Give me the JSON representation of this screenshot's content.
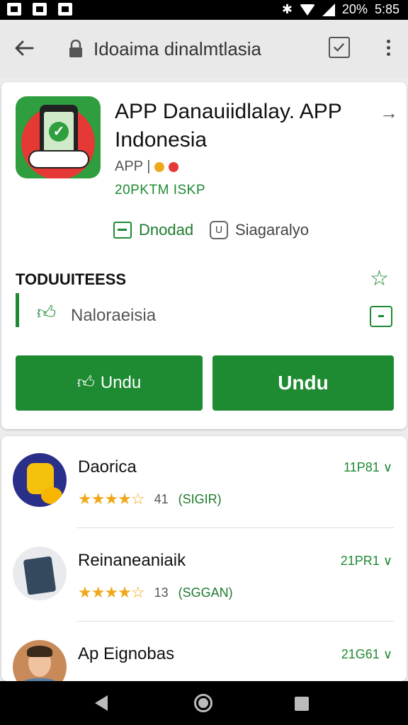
{
  "status_bar": {
    "battery": "20%",
    "time": "5:85"
  },
  "address_bar": {
    "url": "Idoaima dinalmtlasia",
    "icons": [
      "back-arrow-icon",
      "lock-icon",
      "tab-switcher-icon",
      "overflow-menu-icon"
    ]
  },
  "app": {
    "title": "APP Danauiidlalay. APP Indonesia",
    "meta_label": "APP |",
    "size_info": "20PKTM ISKP",
    "download_label": "Dnodad",
    "share_label": "Siagaralyo",
    "section_heading": "TODUUITEESS",
    "feature_label": "Naloraeisia",
    "button_left_label": "Undu",
    "button_right_label": "Undu",
    "colors": {
      "accent": "#1e8a32",
      "star": "#f0a81b"
    }
  },
  "list": {
    "items": [
      {
        "name": "Daorica",
        "date": "11P81",
        "stars": "★★★★☆",
        "count": "41",
        "extra": "(SIGIR)",
        "chevron": "∨"
      },
      {
        "name": "Reinaneaniaik",
        "date": "21PR1",
        "stars": "★★★★☆",
        "count": "13",
        "extra": "(SGGAN)",
        "chevron": "∨"
      },
      {
        "name": "Ap Eignobas",
        "date": "21G61",
        "chevron": "∨"
      }
    ]
  },
  "nav_bar": {
    "icons": [
      "nav-back-icon",
      "nav-home-icon",
      "nav-recent-icon"
    ]
  }
}
